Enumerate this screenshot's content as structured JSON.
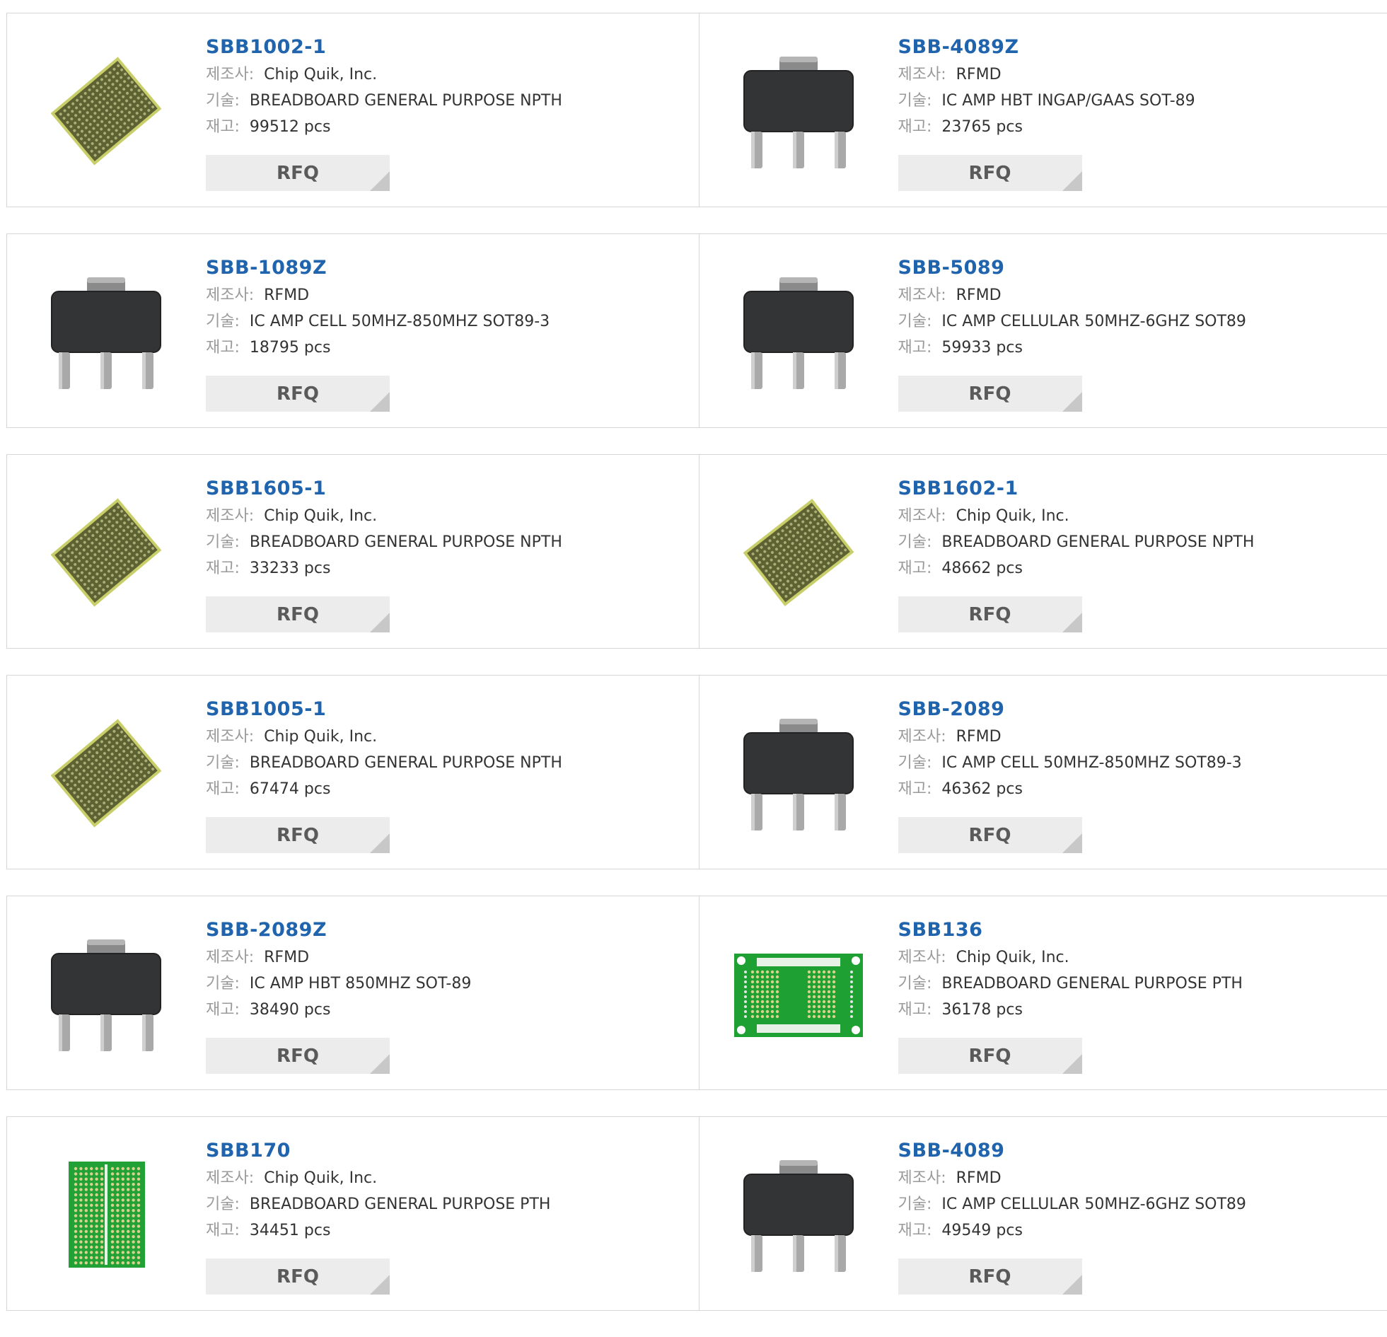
{
  "labels": {
    "manufacturer": "제조사:",
    "description": "기술:",
    "stock": "재고:",
    "rfq": "RFQ"
  },
  "products": [
    {
      "name": "SBB1002-1",
      "manufacturer": "Chip Quik, Inc.",
      "description": "BREADBOARD GENERAL PURPOSE NPTH",
      "stock": "99512 pcs",
      "image_icon": "breadboard-npth-icon"
    },
    {
      "name": "SBB-4089Z",
      "manufacturer": "RFMD",
      "description": "IC AMP HBT INGAP/GAAS SOT-89",
      "stock": "23765 pcs",
      "image_icon": "sot89-chip-icon"
    },
    {
      "name": "SBB-1089Z",
      "manufacturer": "RFMD",
      "description": "IC AMP CELL 50MHZ-850MHZ SOT89-3",
      "stock": "18795 pcs",
      "image_icon": "sot89-chip-icon"
    },
    {
      "name": "SBB-5089",
      "manufacturer": "RFMD",
      "description": "IC AMP CELLULAR 50MHZ-6GHZ SOT89",
      "stock": "59933 pcs",
      "image_icon": "sot89-chip-icon"
    },
    {
      "name": "SBB1605-1",
      "manufacturer": "Chip Quik, Inc.",
      "description": "BREADBOARD GENERAL PURPOSE NPTH",
      "stock": "33233 pcs",
      "image_icon": "breadboard-npth-icon"
    },
    {
      "name": "SBB1602-1",
      "manufacturer": "Chip Quik, Inc.",
      "description": "BREADBOARD GENERAL PURPOSE NPTH",
      "stock": "48662 pcs",
      "image_icon": "breadboard-npth-icon"
    },
    {
      "name": "SBB1005-1",
      "manufacturer": "Chip Quik, Inc.",
      "description": "BREADBOARD GENERAL PURPOSE NPTH",
      "stock": "67474 pcs",
      "image_icon": "breadboard-npth-icon"
    },
    {
      "name": "SBB-2089",
      "manufacturer": "RFMD",
      "description": "IC AMP CELL 50MHZ-850MHZ SOT89-3",
      "stock": "46362 pcs",
      "image_icon": "sot89-chip-icon"
    },
    {
      "name": "SBB-2089Z",
      "manufacturer": "RFMD",
      "description": "IC AMP HBT 850MHZ SOT-89",
      "stock": "38490 pcs",
      "image_icon": "sot89-chip-icon"
    },
    {
      "name": "SBB136",
      "manufacturer": "Chip Quik, Inc.",
      "description": "BREADBOARD GENERAL PURPOSE PTH",
      "stock": "36178 pcs",
      "image_icon": "breadboard-pth-green-icon"
    },
    {
      "name": "SBB170",
      "manufacturer": "Chip Quik, Inc.",
      "description": "BREADBOARD GENERAL PURPOSE PTH",
      "stock": "34451 pcs",
      "image_icon": "breadboard-pth-green-small-icon"
    },
    {
      "name": "SBB-4089",
      "manufacturer": "RFMD",
      "description": "IC AMP CELLULAR 50MHZ-6GHZ SOT89",
      "stock": "49549 pcs",
      "image_icon": "sot89-chip-icon"
    }
  ],
  "colors": {
    "product_name": "#1f64ad",
    "label": "#9a9a9a",
    "text": "#333333",
    "rfq_bg": "#ececec",
    "border": "#d6d6d6"
  }
}
